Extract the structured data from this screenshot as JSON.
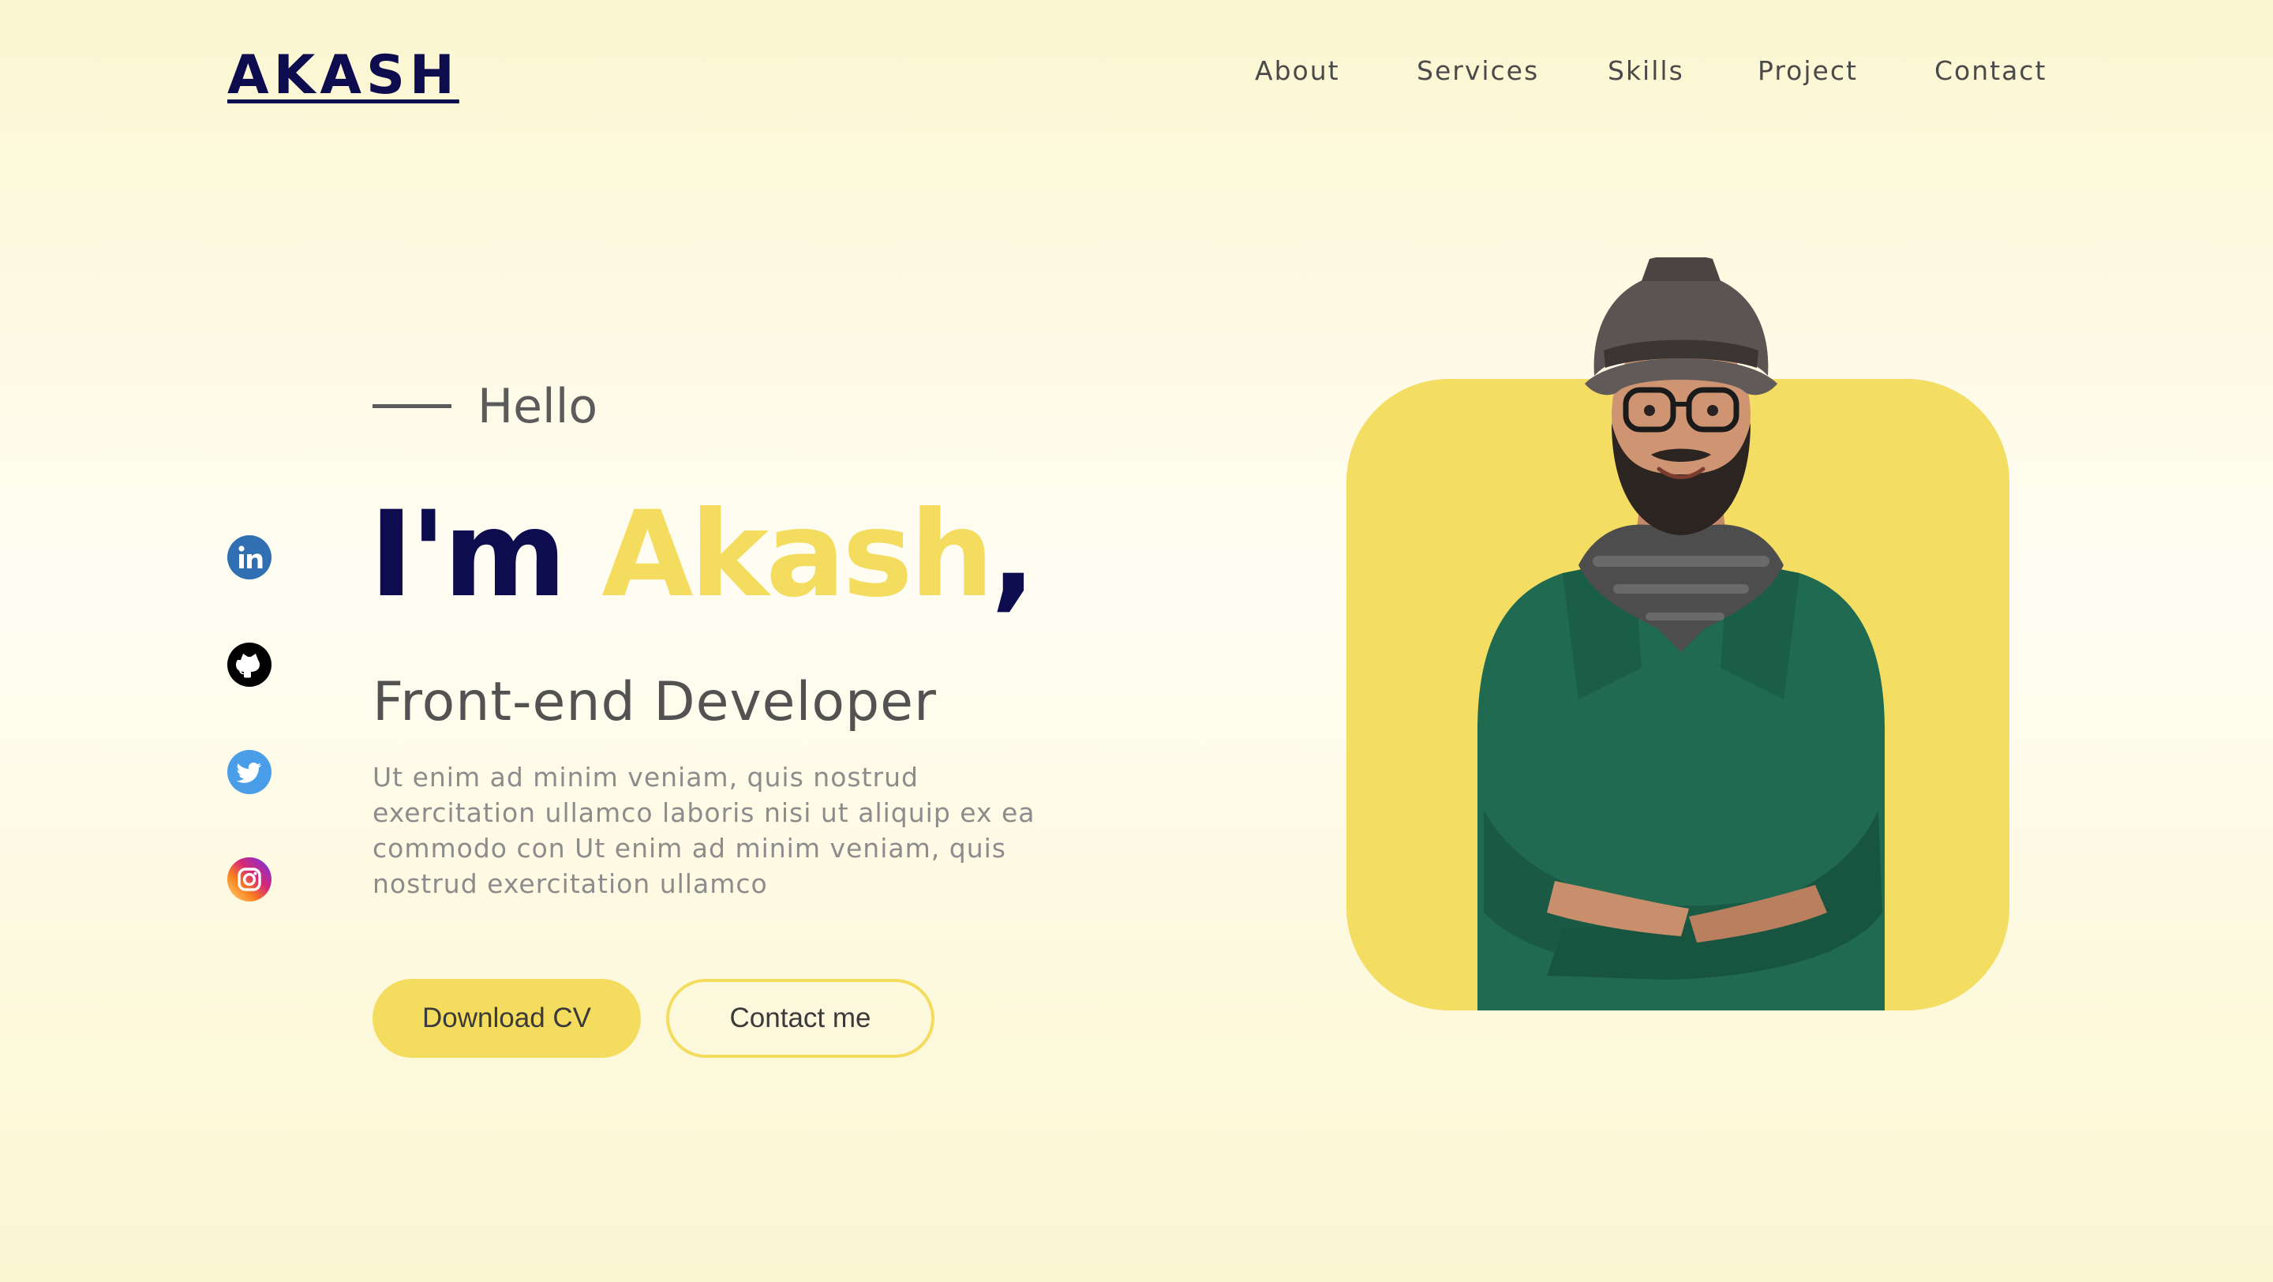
{
  "logo": {
    "text": "AKASH"
  },
  "nav": {
    "items": [
      {
        "label": "About"
      },
      {
        "label": "Services"
      },
      {
        "label": "Skills"
      },
      {
        "label": "Project"
      },
      {
        "label": "Contact"
      }
    ]
  },
  "hero": {
    "greeting": "Hello",
    "headline_prefix": "I'm",
    "name": "Akash",
    "headline_suffix": ",",
    "role": "Front-end Developer",
    "description": "Ut enim ad minim veniam, quis nostrud exercitation ullamco laboris nisi ut aliquip ex ea commodo con Ut enim ad minim veniam, quis nostrud exercitation ullamco",
    "download_button": "Download CV",
    "contact_button": "Contact me"
  },
  "social": [
    {
      "icon": "linkedin-icon",
      "color": "#2f6fb2"
    },
    {
      "icon": "github-icon",
      "color": "#000000"
    },
    {
      "icon": "twitter-icon",
      "color": "#4a9ee8"
    },
    {
      "icon": "instagram-icon",
      "color": "#d62976"
    }
  ],
  "colors": {
    "navy": "#0d0c4e",
    "accent_yellow": "#f4dc5f",
    "text_gray": "#5b5b5b",
    "body_gray": "#8c8c8c",
    "background": "#fcf8dc"
  },
  "photo": {
    "subject": "smiling bearded man in hat, glasses, scarf and green sweater with crossed arms"
  }
}
